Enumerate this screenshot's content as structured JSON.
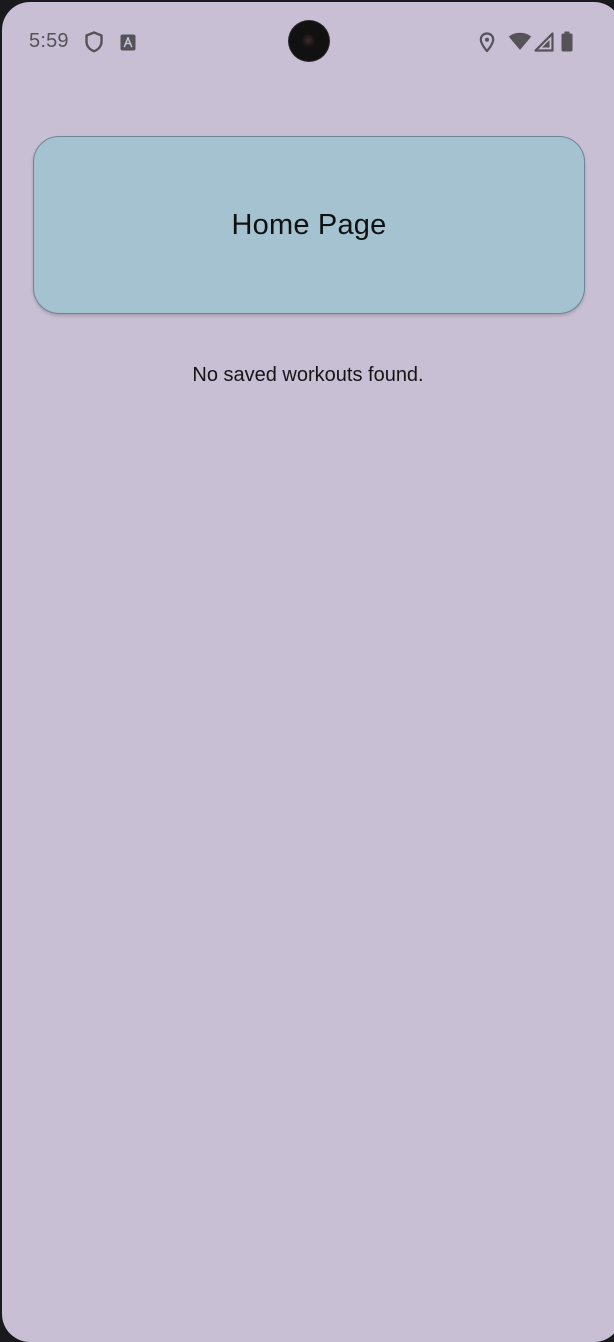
{
  "status_bar": {
    "time": "5:59",
    "left_icons": [
      "shield-icon",
      "font-a-icon"
    ],
    "right_icons": [
      "location-icon",
      "wifi-icon",
      "cell-signal-icon",
      "battery-icon"
    ]
  },
  "header": {
    "title": "Home Page"
  },
  "main": {
    "empty_message": "No saved workouts found."
  },
  "colors": {
    "background": "#c9bfd5",
    "header_card": "#a4c2d0",
    "header_border": "#6e8597"
  }
}
